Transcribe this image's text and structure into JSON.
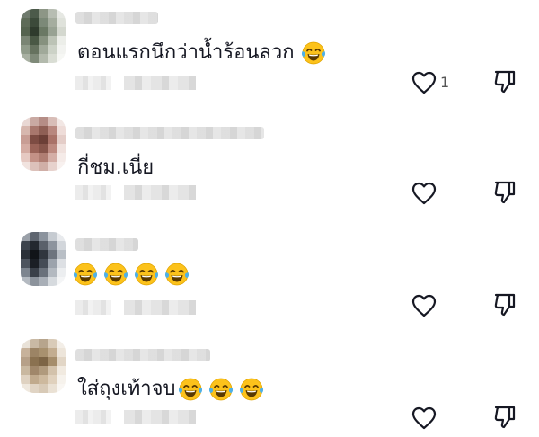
{
  "comments": [
    {
      "text": "ตอนแรกนึกว่าน้ำร้อนลวก",
      "emoji_count": 1,
      "like_count": "1",
      "avatar_palette": [
        "#6f7a6d",
        "#4c5a4a",
        "#8d9686",
        "#b7bdb2",
        "#e6e8e3",
        "#5e6b58",
        "#3c4a3a",
        "#7c8978",
        "#a5ad9f",
        "#dfe2db",
        "#55634f",
        "#2f3b2d",
        "#6a7864",
        "#98a293",
        "#d4d8cf",
        "#7a8574",
        "#4a5845",
        "#86917f",
        "#bcc3b6",
        "#eceee9",
        "#909b8a",
        "#66725f",
        "#a0a99a",
        "#ccd2c7",
        "#f2f3f0",
        "#a8b0a2",
        "#7f8a79",
        "#b3baad",
        "#d9ddd4",
        "#f6f7f4"
      ]
    },
    {
      "text": "กี่ชม.เนี่ย",
      "emoji_count": 0,
      "like_count": "",
      "avatar_palette": [
        "#e9d8d4",
        "#c9a9a2",
        "#b58d86",
        "#d8bdb7",
        "#f2e7e4",
        "#d7b7ae",
        "#a8776d",
        "#8f5f55",
        "#b8877e",
        "#eedcd8",
        "#c89d94",
        "#7d4c43",
        "#6c3f37",
        "#a97268",
        "#e4cdc8",
        "#d5aca3",
        "#9a6358",
        "#87554b",
        "#bd8a80",
        "#f0e1dd",
        "#e6c9c2",
        "#c39186",
        "#b07e73",
        "#d4aea6",
        "#f5ebe8",
        "#f1e3df",
        "#dcc1ba",
        "#d0afa7",
        "#e7d2cd",
        "#f8f1ef"
      ]
    },
    {
      "text": "",
      "emoji_count": 4,
      "like_count": "",
      "avatar_palette": [
        "#9aa0a8",
        "#5f6670",
        "#8b939d",
        "#c6cbd1",
        "#e8eaed",
        "#3c434c",
        "#23282f",
        "#5a616b",
        "#8d949e",
        "#d2d6db",
        "#2a3038",
        "#111418",
        "#30363e",
        "#6d747e",
        "#b9bfc6",
        "#4d545e",
        "#1b1f25",
        "#454c56",
        "#9ca3ac",
        "#dde0e4",
        "#7d858f",
        "#3a4049",
        "#6a717b",
        "#b3b9c0",
        "#eceef0",
        "#b4bac1",
        "#8c939c",
        "#a9afb7",
        "#d6dade",
        "#f4f5f6"
      ]
    },
    {
      "text": "ใส่ถุงเท้าจบ",
      "emoji_count": 3,
      "like_count": "",
      "avatar_palette": [
        "#e9e2d8",
        "#c9b9a4",
        "#b7a58d",
        "#d9cbb8",
        "#f3eee7",
        "#c7b29b",
        "#9c8465",
        "#a8916f",
        "#c3ad90",
        "#ede5da",
        "#b6a088",
        "#8a7150",
        "#7d6546",
        "#a58d6b",
        "#e2d6c6",
        "#c9b8a0",
        "#a0876a",
        "#b09a7d",
        "#d3c2ab",
        "#f1eae0",
        "#dfd2c1",
        "#c0aa8d",
        "#cdb99e",
        "#e0d1bd",
        "#f6f2ec",
        "#efe8de",
        "#e0d4c4",
        "#d8cab7",
        "#eae1d4",
        "#f9f6f2"
      ]
    }
  ],
  "icons": {
    "like": "heart-outline-icon",
    "dislike": "thumbs-down-icon",
    "emoji": "face-tears-of-joy-emoji"
  },
  "colors": {
    "text": "#161823",
    "icon": "#161823",
    "emoji_face": "#fcc21b",
    "emoji_tear": "#4fb0e6"
  }
}
